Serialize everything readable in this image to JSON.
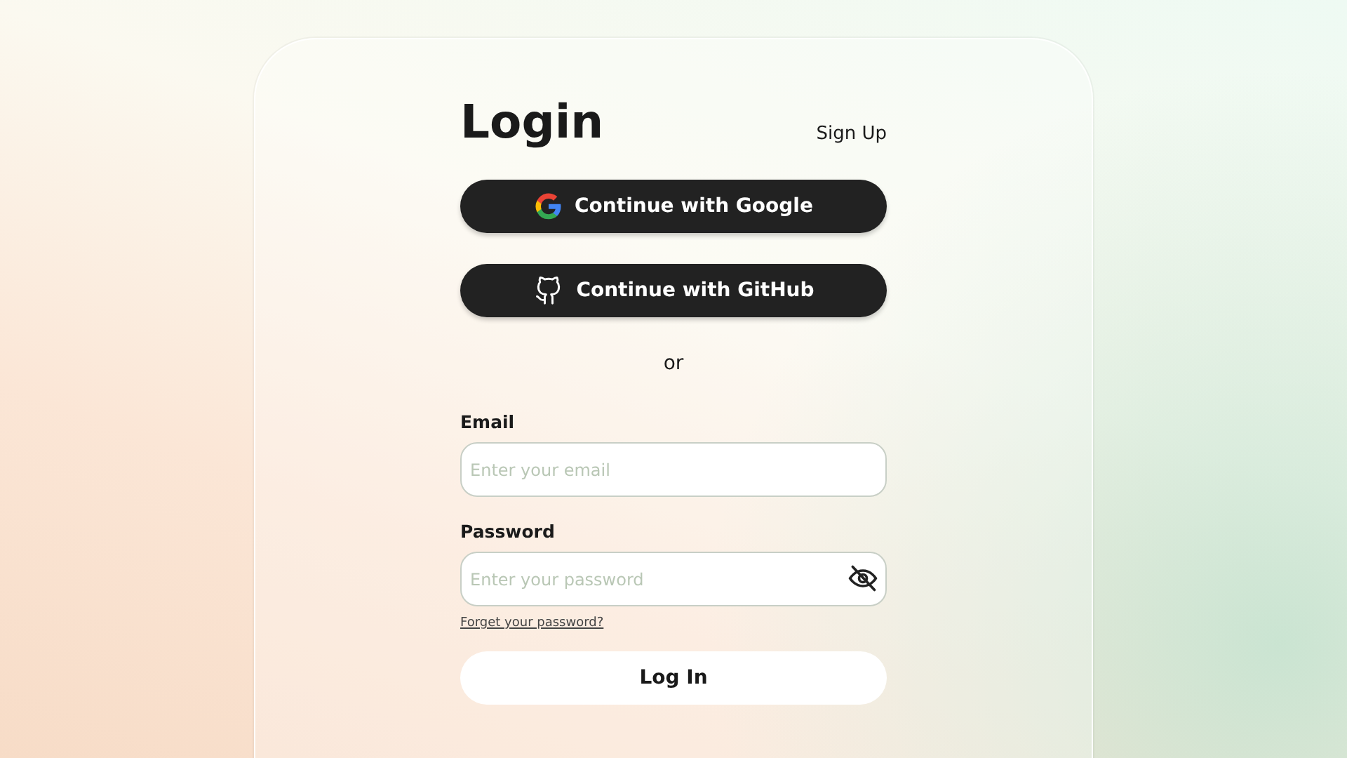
{
  "title": "Login",
  "sign_up": "Sign Up",
  "social_buttons": [
    {
      "kind": "google",
      "label": "Continue with Google"
    },
    {
      "kind": "github",
      "label": "Continue with GitHub"
    }
  ],
  "divider": "or",
  "fields": [
    {
      "kind": "email",
      "label": "Email",
      "placeholder": "Enter your email"
    },
    {
      "kind": "password",
      "label": "Password",
      "placeholder": "Enter your password"
    }
  ],
  "forgot_link": "Forget your password?",
  "submit": "Log In"
}
